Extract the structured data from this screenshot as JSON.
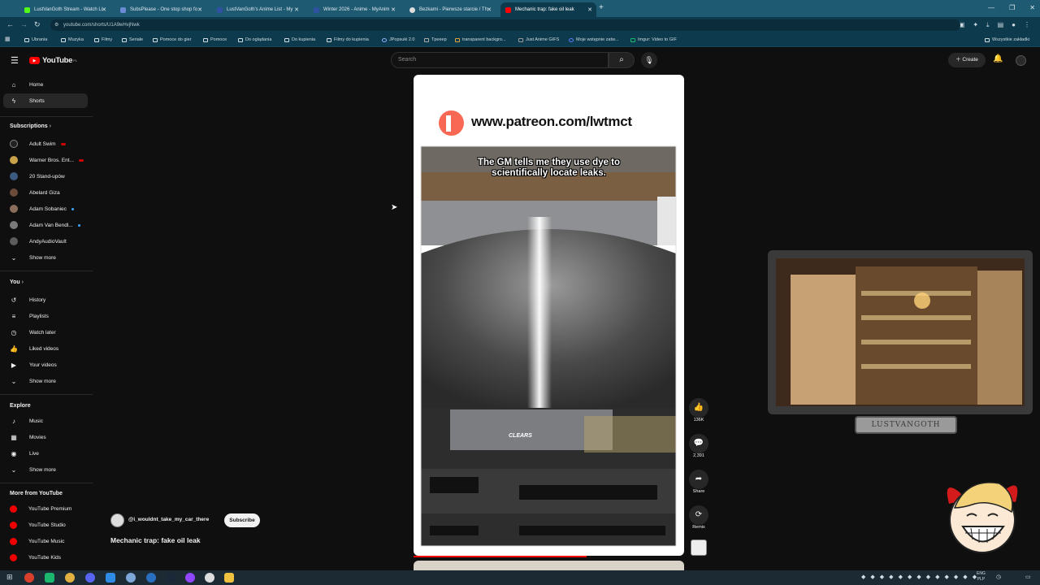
{
  "browser": {
    "tabs": [
      {
        "label": "LustVanGoth Stream - Watch Li",
        "favicon_color": "#53fc18"
      },
      {
        "label": "SubsPlease - One stop shop fo",
        "favicon_color": "#6b8bd6"
      },
      {
        "label": "LustVanGoth's Anime List - My",
        "favicon_color": "#2e51a2"
      },
      {
        "label": "Winter 2026 - Anime - MyAnim",
        "favicon_color": "#2e51a2"
      },
      {
        "label": "Bezkami - Pierwsze starcie / Th",
        "favicon_color": "#dddddd"
      },
      {
        "label": "Mechanic trap: fake oil leak",
        "favicon_color": "#ff0000"
      }
    ],
    "url": "youtube.com/shorts/U1A9wHvjNwk",
    "bookmarks": [
      "Ubrania",
      "Muzyka",
      "Filmy",
      "Seriale",
      "Pomoce do gier",
      "Pomoce",
      "Do oglądania",
      "Do kupienia",
      "Filmy do kupienia",
      "JPopsuki 2.0",
      "Tpeeep",
      "transparent backgro...",
      "Just Anime GIFS",
      "Moje wstępnie zatw...",
      "Imgur: Video to GIF"
    ],
    "all_bookmarks": "Wszystkie zakładki"
  },
  "youtube": {
    "logo": "YouTube",
    "country": "PL",
    "search_placeholder": "Search",
    "create_label": "Create",
    "sidebar": {
      "home": "Home",
      "shorts": "Shorts",
      "subscriptions": "Subscriptions",
      "subs": [
        {
          "name": "Adult Swim",
          "color": "#222"
        },
        {
          "name": "Warner Bros. Ent...",
          "color": "#c9a24a"
        },
        {
          "name": "20 Stand-upów",
          "color": "#3d5a80"
        },
        {
          "name": "Abelard Giza",
          "color": "#6b4c3b"
        },
        {
          "name": "Adam Sobaniec",
          "color": "#8a6d5a"
        },
        {
          "name": "Adam Van Bendl...",
          "color": "#7a7a7a"
        },
        {
          "name": "AndyAudioVault",
          "color": "#5c5c5c"
        }
      ],
      "show_more": "Show more",
      "you": "You",
      "you_items": [
        "History",
        "Playlists",
        "Watch later",
        "Liked videos",
        "Your videos"
      ],
      "explore": "Explore",
      "explore_items": [
        "Music",
        "Movies",
        "Live"
      ],
      "more_from": "More from YouTube",
      "more_items": [
        "YouTube Premium",
        "YouTube Studio",
        "YouTube Music",
        "YouTube Kids"
      ]
    },
    "short": {
      "patreon_text": "www.patreon.com/lwtmct",
      "caption": "The GM tells me they use dye to scientifically locate leaks.",
      "channel": "@i_wouldnt_take_my_car_there",
      "subscribe": "Subscribe",
      "title": "Mechanic trap: fake oil leak",
      "likes": "136K",
      "comments": "2,391",
      "share": "Share",
      "remix": "Remix",
      "dash_sign": "CLEARS"
    },
    "overlay_name": "LUSTVANGOTH"
  },
  "taskbar": {
    "lang_top": "ENG",
    "lang_bottom": "PLP"
  }
}
